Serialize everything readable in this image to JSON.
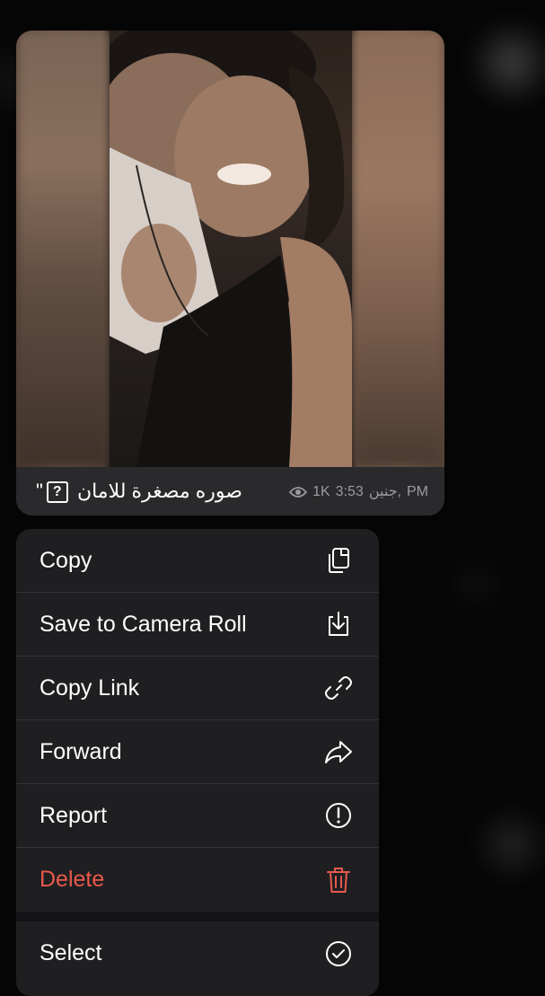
{
  "message": {
    "caption": "صوره مصغرة للامان",
    "caption_prefix_quote": "\"",
    "caption_box_glyph": "?",
    "views": "1K",
    "time": "3:53",
    "date_label": "جنين,",
    "ampm": "PM"
  },
  "menu": {
    "items": [
      {
        "label": "Copy",
        "icon": "copy-icon"
      },
      {
        "label": "Save to Camera Roll",
        "icon": "save-download-icon"
      },
      {
        "label": "Copy Link",
        "icon": "link-icon"
      },
      {
        "label": "Forward",
        "icon": "forward-arrow-icon"
      },
      {
        "label": "Report",
        "icon": "report-exclamation-icon"
      },
      {
        "label": "Delete",
        "icon": "trash-icon"
      },
      {
        "label": "Select",
        "icon": "select-checkmark-icon"
      }
    ]
  },
  "colors": {
    "menu_background": "#1f1f21",
    "danger": "#e8594c",
    "bubble_background": "#2a2a2c",
    "meta_text": "#9a9aa0"
  }
}
